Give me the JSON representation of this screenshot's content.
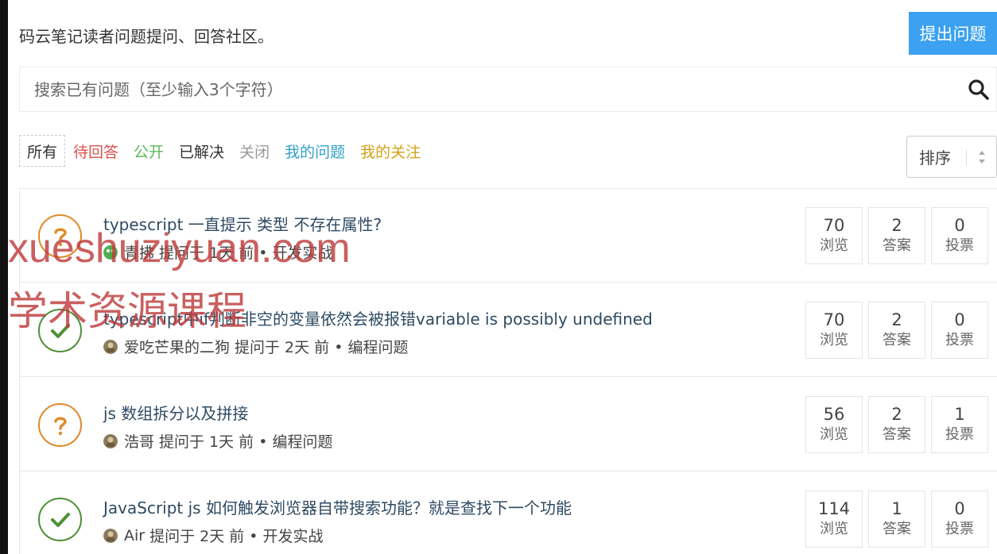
{
  "header": {
    "intro": "码云笔记读者问题提问、回答社区。",
    "ask_button": "提出问题"
  },
  "search": {
    "placeholder": "搜索已有问题（至少输入3个字符）",
    "icon": "search-icon"
  },
  "filters": [
    {
      "label": "所有",
      "color": "#333333"
    },
    {
      "label": "待回答",
      "color": "#d9534f"
    },
    {
      "label": "公开",
      "color": "#5cb85c"
    },
    {
      "label": "已解决",
      "color": "#333333"
    },
    {
      "label": "关闭",
      "color": "#999999"
    },
    {
      "label": "我的问题",
      "color": "#31a0c8"
    },
    {
      "label": "我的关注",
      "color": "#d4a017"
    }
  ],
  "sort": {
    "label": "排序"
  },
  "stat_labels": {
    "views": "浏览",
    "answers": "答案",
    "votes": "投票"
  },
  "questions": [
    {
      "status": "unanswered",
      "title": "typescript 一直提示 类型 不存在属性?",
      "author": "青拂",
      "meta": "提问于 1天 前 • 开发实战",
      "views": "70",
      "answers": "2",
      "votes": "0"
    },
    {
      "status": "solved",
      "title": "typescript中if判断非空的变量依然会被报错variable is possibly undefined",
      "author": "爱吃芒果的二狗",
      "meta": "提问于 2天 前 • 编程问题",
      "views": "70",
      "answers": "2",
      "votes": "0"
    },
    {
      "status": "unanswered",
      "title": "js 数组拆分以及拼接",
      "author": "浩哥",
      "meta": "提问于 1天 前 • 编程问题",
      "views": "56",
      "answers": "2",
      "votes": "1"
    },
    {
      "status": "solved",
      "title": "JavaScript js 如何触发浏览器自带搜索功能？就是查找下一个功能",
      "author": "Air",
      "meta": "提问于 2天 前 • 开发实战",
      "views": "114",
      "answers": "1",
      "votes": "0"
    }
  ],
  "watermark": {
    "line1": "xueshuziyuan.com",
    "line2": "学术资源课程"
  }
}
